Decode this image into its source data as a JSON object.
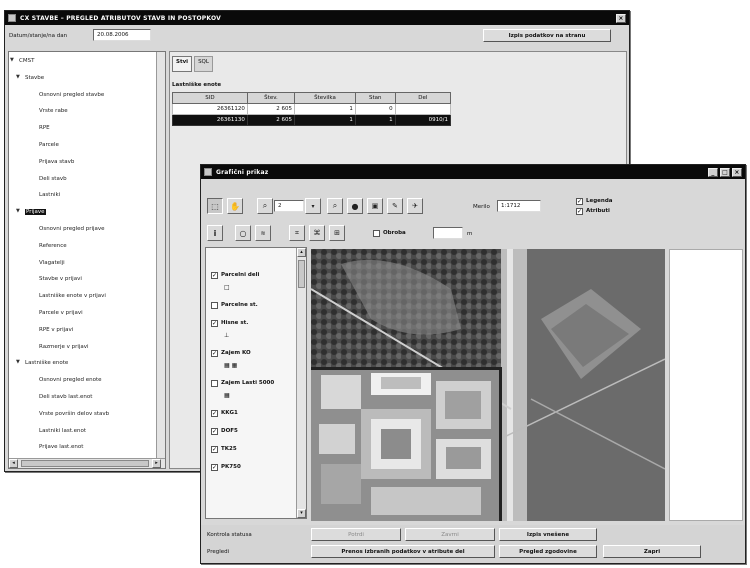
{
  "back_window": {
    "title": "CX STAVBE – PREGLED ATRIBUTOV STAVB IN POSTOPKOV",
    "date_label": "Datum/stanje/na dan",
    "date_value": "20.08.2006",
    "action_button": "Izpis podatkov na stranu",
    "tabs": [
      "Stvi",
      "SQL"
    ],
    "table_title": "Lastniške enote",
    "table": {
      "columns": [
        "SID",
        "Štev.",
        "Številka",
        "Stan",
        "Del"
      ],
      "rows": [
        [
          "26361120",
          "2 605",
          "1",
          "0",
          ""
        ],
        [
          "26361130",
          "2 605",
          "1",
          "1",
          "0910/1"
        ]
      ],
      "selected_row": 1
    },
    "tree": [
      {
        "label": "CMST",
        "level": 0,
        "toggle": "▼"
      },
      {
        "label": "Stavbe",
        "level": 1,
        "toggle": "▼"
      },
      {
        "label": "Osnovni pregled stavbe",
        "level": 2
      },
      {
        "label": "Vrste rabe",
        "level": 2
      },
      {
        "label": "RPE",
        "level": 2
      },
      {
        "label": "Parcele",
        "level": 2
      },
      {
        "label": "Prijava stavb",
        "level": 2
      },
      {
        "label": "Deli stavb",
        "level": 2
      },
      {
        "label": "Lastniki",
        "level": 2
      },
      {
        "label": "Prijave",
        "level": 1,
        "toggle": "▼",
        "selected": true
      },
      {
        "label": "Osnovni pregled prijave",
        "level": 2
      },
      {
        "label": "Reference",
        "level": 2
      },
      {
        "label": "Vlagatelji",
        "level": 2
      },
      {
        "label": "Stavbe v prijavi",
        "level": 2
      },
      {
        "label": "Lastniške enote v prijavi",
        "level": 2
      },
      {
        "label": "Parcele v prijavi",
        "level": 2
      },
      {
        "label": "RPE v prijavi",
        "level": 2
      },
      {
        "label": "Razmerje v prijavi",
        "level": 2
      },
      {
        "label": "Lastniške enote",
        "level": 1,
        "toggle": "▼"
      },
      {
        "label": "Osnovni pregled enote",
        "level": 2
      },
      {
        "label": "Deli stavb last.enot",
        "level": 2
      },
      {
        "label": "Vrste površin delov stavb",
        "level": 2
      },
      {
        "label": "Lastniki last.enot",
        "level": 2
      },
      {
        "label": "Prijave last.enot",
        "level": 2
      }
    ]
  },
  "front_window": {
    "title": "Grafični prikaz",
    "zoom_value": "2",
    "merilo_label": "Merilo",
    "merilo_value": "1:1712",
    "legend_label": "Legenda",
    "atributi_label": "Atributi",
    "obroba_label": "Obroba",
    "obroba_unit": "m",
    "toolbar_icons": [
      "select-icon",
      "pan-icon",
      "zoom-icon",
      "dropdown-icon",
      "zoom-out-icon",
      "layers-icon",
      "window-icon",
      "edit-icon",
      "bird-icon"
    ],
    "toolbar2_icons": [
      "info-icon",
      "circle-icon",
      "measure-icon",
      "tool-a-icon",
      "tool-b-icon",
      "tool-c-icon"
    ],
    "layers": [
      {
        "label": "Parcelni deli",
        "checked": true,
        "swatch": "□"
      },
      {
        "label": "Parcelne st.",
        "checked": false
      },
      {
        "label": "Hisne st.",
        "checked": true,
        "swatch": "⊥"
      },
      {
        "label": "Zajem KO",
        "checked": true,
        "swatch": "▦ ▦"
      },
      {
        "label": "Zajem Lasti 5000",
        "checked": false,
        "swatch": "▦"
      },
      {
        "label": "KKG1",
        "checked": true
      },
      {
        "label": "DOF5",
        "checked": true
      },
      {
        "label": "TK25",
        "checked": true
      },
      {
        "label": "PK750",
        "checked": true
      }
    ],
    "bottom": {
      "row1_label": "Kontrola statusa",
      "row1_buttons": [
        "Potrdi",
        "Zavrni",
        "Izpis vnešene"
      ],
      "row2_label": "Pregledi",
      "row2_buttons": [
        "Prenos izbranih podatkov v atribute del",
        "Pregled zgodovine",
        "Zapri"
      ]
    }
  }
}
